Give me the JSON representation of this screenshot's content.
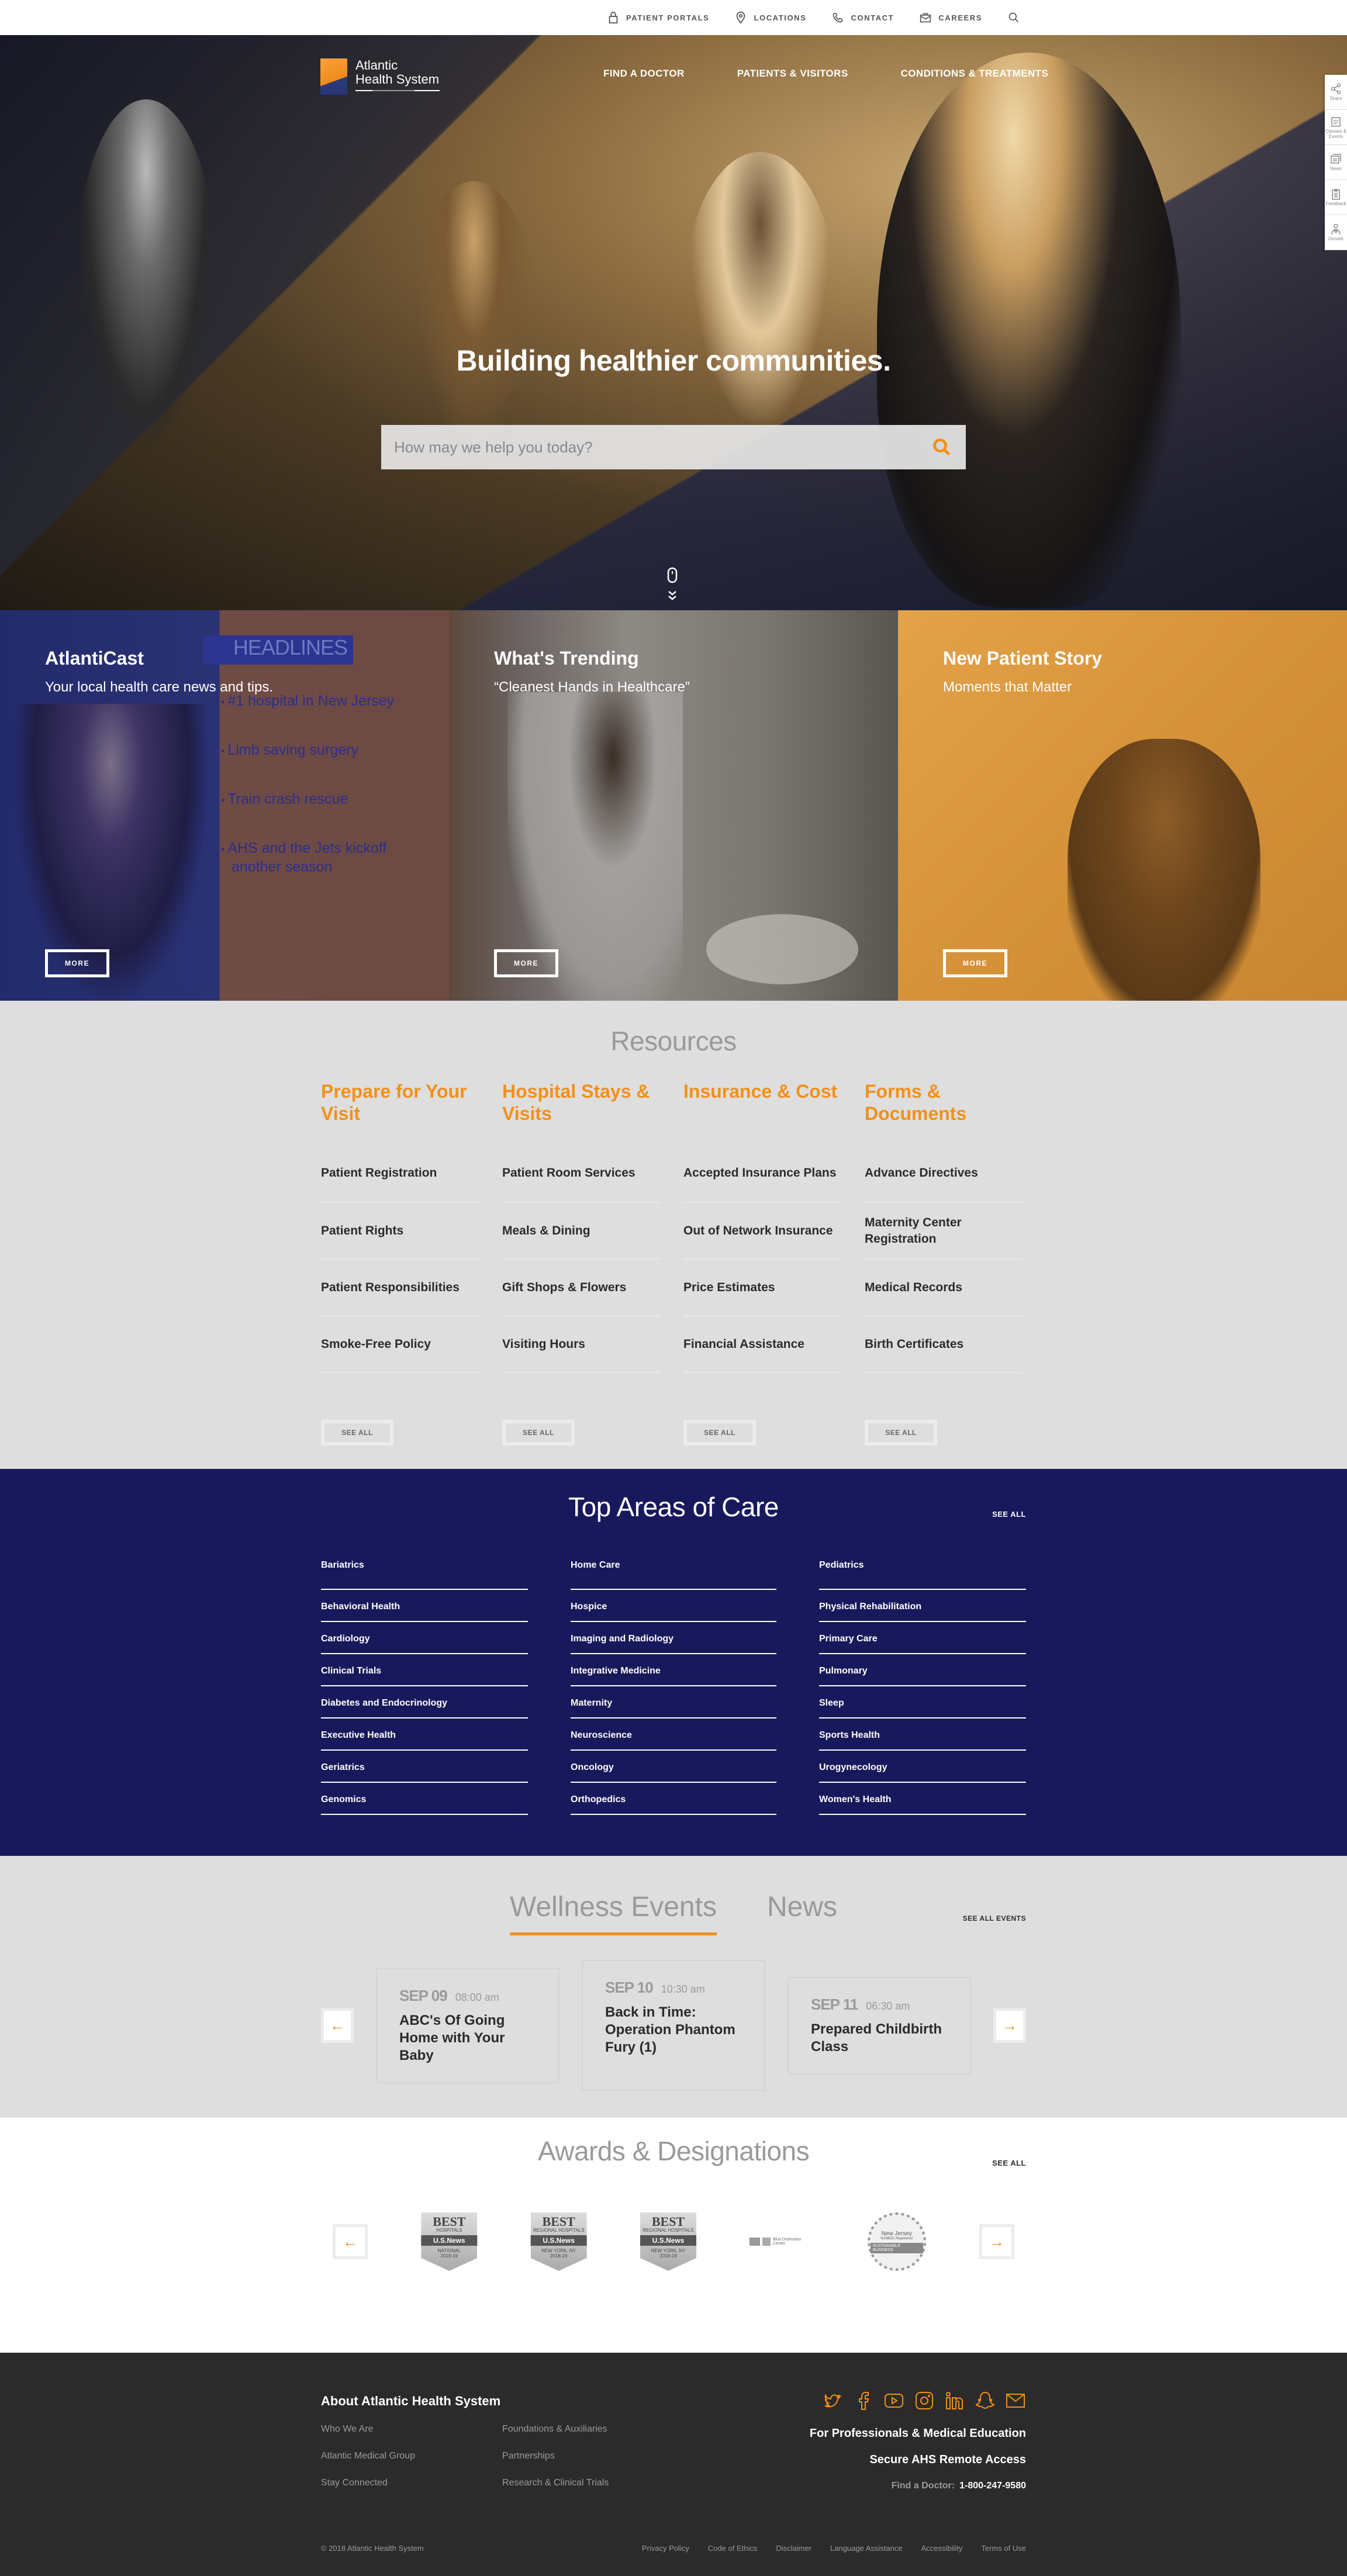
{
  "utility_nav": [
    {
      "label": "PATIENT PORTALS",
      "icon": "lock-icon"
    },
    {
      "label": "LOCATIONS",
      "icon": "map-pin-icon"
    },
    {
      "label": "CONTACT",
      "icon": "phone-icon"
    },
    {
      "label": "CAREERS",
      "icon": "briefcase-icon"
    }
  ],
  "brand": {
    "line1": "Atlantic",
    "line2": "Health System"
  },
  "main_nav": [
    "FIND A DOCTOR",
    "PATIENTS & VISITORS",
    "CONDITIONS & TREATMENTS"
  ],
  "hero": {
    "title": "Building healthier communities.",
    "search_placeholder": "How may we help you today?"
  },
  "side_dock": [
    "Share",
    "Classes & Events",
    "News",
    "Feedback",
    "Donate"
  ],
  "tiles": [
    {
      "title": "AtlantiCast",
      "subtitle": "Your local health care news and tips.",
      "button": "MORE",
      "headlines_label": "HEADLINES",
      "headlines": [
        "#1 hospital in New Jersey",
        "Limb saving surgery",
        "Train crash rescue",
        "AHS and the Jets kickoff another season"
      ]
    },
    {
      "title": "What's Trending",
      "subtitle": "“Cleanest Hands in Healthcare”",
      "button": "MORE"
    },
    {
      "title": "New Patient Story",
      "subtitle": "Moments that Matter",
      "button": "MORE"
    }
  ],
  "resources": {
    "title": "Resources",
    "see_all": "SEE ALL",
    "columns": [
      {
        "heading": "Prepare for Your Visit",
        "links": [
          "Patient Registration",
          "Patient Rights",
          "Patient Responsibilities",
          "Smoke-Free Policy"
        ]
      },
      {
        "heading": "Hospital Stays & Visits",
        "links": [
          "Patient Room Services",
          "Meals & Dining",
          "Gift Shops & Flowers",
          "Visiting Hours"
        ]
      },
      {
        "heading": "Insurance & Cost",
        "links": [
          "Accepted Insurance Plans",
          "Out of Network Insurance",
          "Price Estimates",
          "Financial Assistance"
        ]
      },
      {
        "heading": "Forms & Documents",
        "links": [
          "Advance Directives",
          "Maternity Center Registration",
          "Medical Records",
          "Birth Certificates"
        ]
      }
    ]
  },
  "care": {
    "title": "Top Areas of Care",
    "see_all": "SEE ALL",
    "columns": [
      [
        "Bariatrics",
        "Behavioral Health",
        "Cardiology",
        "Clinical Trials",
        "Diabetes and Endocrinology",
        "Executive Health",
        "Geriatrics",
        "Genomics"
      ],
      [
        "Home Care",
        "Hospice",
        "Imaging and Radiology",
        "Integrative Medicine",
        "Maternity",
        "Neuroscience",
        "Oncology",
        "Orthopedics"
      ],
      [
        "Pediatrics",
        "Physical Rehabilitation",
        "Primary Care",
        "Pulmonary",
        "Sleep",
        "Sports Health",
        "Urogynecology",
        "Women's Health"
      ]
    ]
  },
  "events": {
    "tabs": [
      "Wellness Events",
      "News"
    ],
    "active_tab": "Wellness Events",
    "see_all": "SEE ALL EVENTS",
    "items": [
      {
        "date": "SEP 09",
        "time": "08:00 am",
        "title": "ABC's Of Going Home with Your Baby"
      },
      {
        "date": "SEP 10",
        "time": "10:30 am",
        "title": "Back in Time: Operation Phantom Fury (1)"
      },
      {
        "date": "SEP 11",
        "time": "06:30 am",
        "title": "Prepared Childbirth Class"
      }
    ]
  },
  "awards": {
    "title": "Awards & Designations",
    "see_all": "SEE ALL",
    "badges": [
      {
        "top": "BEST",
        "sub": "HOSPITALS",
        "brand": "U.S.News",
        "region": "NATIONAL",
        "year": "2018-19"
      },
      {
        "top": "BEST",
        "sub": "REGIONAL HOSPITALS",
        "brand": "U.S.News",
        "region": "NEW YORK, NY",
        "year": "2018-19"
      },
      {
        "top": "BEST",
        "sub": "REGIONAL HOSPITALS",
        "brand": "U.S.News",
        "region": "NEW YORK, NY",
        "year": "2018-19"
      }
    ],
    "blue_distinction": "Blue Distinction Center",
    "seal": {
      "title": "New Jersey",
      "sub": "NJSBDC Registered",
      "band": "SUSTAINABLE BUSINESS"
    }
  },
  "footer": {
    "about_title": "About Atlantic Health System",
    "links": [
      "Who We Are",
      "Foundations & Auxiliaries",
      "Atlantic Medical Group",
      "Partnerships",
      "Stay Connected",
      "Research & Clinical Trials"
    ],
    "socials": [
      "twitter",
      "facebook",
      "youtube",
      "instagram",
      "linkedin",
      "snapchat",
      "email"
    ],
    "professionals": "For Professionals & Medical Education",
    "remote": "Secure AHS Remote Access",
    "find_doctor_label": "Find a Doctor:",
    "phone": "1-800-247-9580",
    "copyright": "© 2018 Atlantic Health System",
    "legal": [
      "Privacy Policy",
      "Code of Ethics",
      "Disclaimer",
      "Language Assistance",
      "Accessibility",
      "Terms of Use"
    ]
  },
  "colors": {
    "accent": "#f39018",
    "navy": "#18195c",
    "gray_bg": "#dedede",
    "footer_bg": "#2b2b2b"
  }
}
